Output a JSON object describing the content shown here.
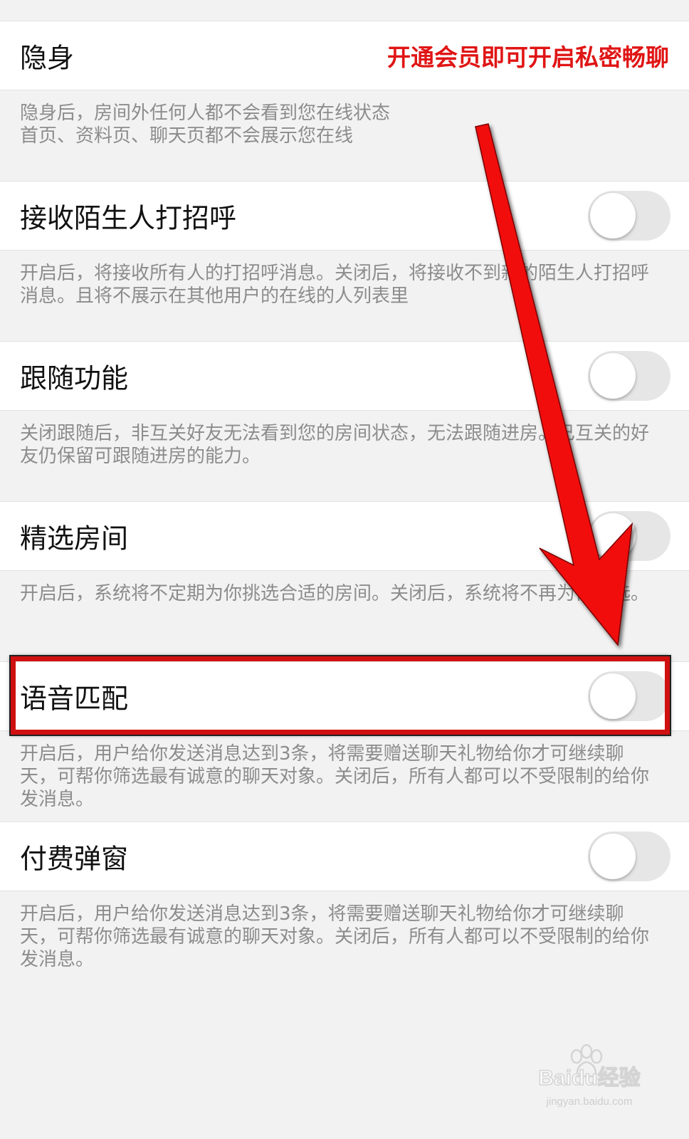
{
  "settings": [
    {
      "title": "隐身",
      "note": "开通会员即可开启私密畅聊",
      "description": "隐身后，房间外任何人都不会看到您在线状态\n首页、资料页、聊天页都不会展示您在线",
      "toggle_on": null
    },
    {
      "title": "接收陌生人打招呼",
      "description": "开启后，将接收所有人的打招呼消息。关闭后，将接收不到新的陌生人打招呼消息。且将不展示在其他用户的在线的人列表里",
      "toggle_on": false
    },
    {
      "title": "跟随功能",
      "description": "关闭跟随后，非互关好友无法看到您的房间状态，无法跟随进房。已互关的好友仍保留可跟随进房的能力。",
      "toggle_on": false
    },
    {
      "title": "精选房间",
      "description": "开启后，系统将不定期为你挑选合适的房间。关闭后，系统将不再为你挑选。",
      "toggle_on": false
    },
    {
      "title": "语音匹配",
      "description": "开启后，用户给你发送消息达到3条，将需要赠送聊天礼物给你才可继续聊天，可帮你筛选最有诚意的聊天对象。关闭后，所有人都可以不受限制的给你发消息。",
      "toggle_on": false
    },
    {
      "title": "付费弹窗",
      "description": "开启后，用户给你发送消息达到3条，将需要赠送聊天礼物给你才可继续聊天，可帮你筛选最有诚意的聊天对象。关闭后，所有人都可以不受限制的给你发消息。",
      "toggle_on": false
    }
  ],
  "watermark": {
    "brand": "Baidu经验",
    "url": "jingyan.baidu.com"
  },
  "colors": {
    "accent_red": "#e01515",
    "toggle_off": "#e6e6e6",
    "page_bg": "#f2f2f2"
  }
}
